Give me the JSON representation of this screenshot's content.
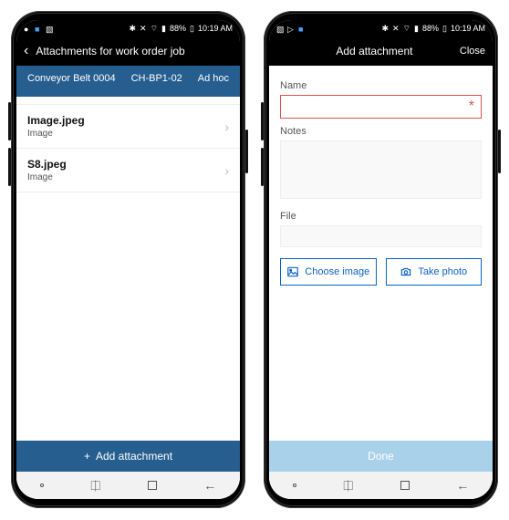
{
  "statusbar": {
    "signal_pct": "88%",
    "time": "10:19 AM"
  },
  "screen1": {
    "title": "Attachments for work order job",
    "header": {
      "asset": "Conveyor Belt 0004",
      "code": "CH-BP1-02",
      "type": "Ad hoc"
    },
    "attachments": [
      {
        "name": "Image.jpeg",
        "type": "Image"
      },
      {
        "name": "S8.jpeg",
        "type": "Image"
      }
    ],
    "add_button": "Add attachment"
  },
  "screen2": {
    "title": "Add attachment",
    "close": "Close",
    "labels": {
      "name": "Name",
      "notes": "Notes",
      "file": "File"
    },
    "buttons": {
      "choose_image": "Choose image",
      "take_photo": "Take photo",
      "done": "Done"
    }
  }
}
